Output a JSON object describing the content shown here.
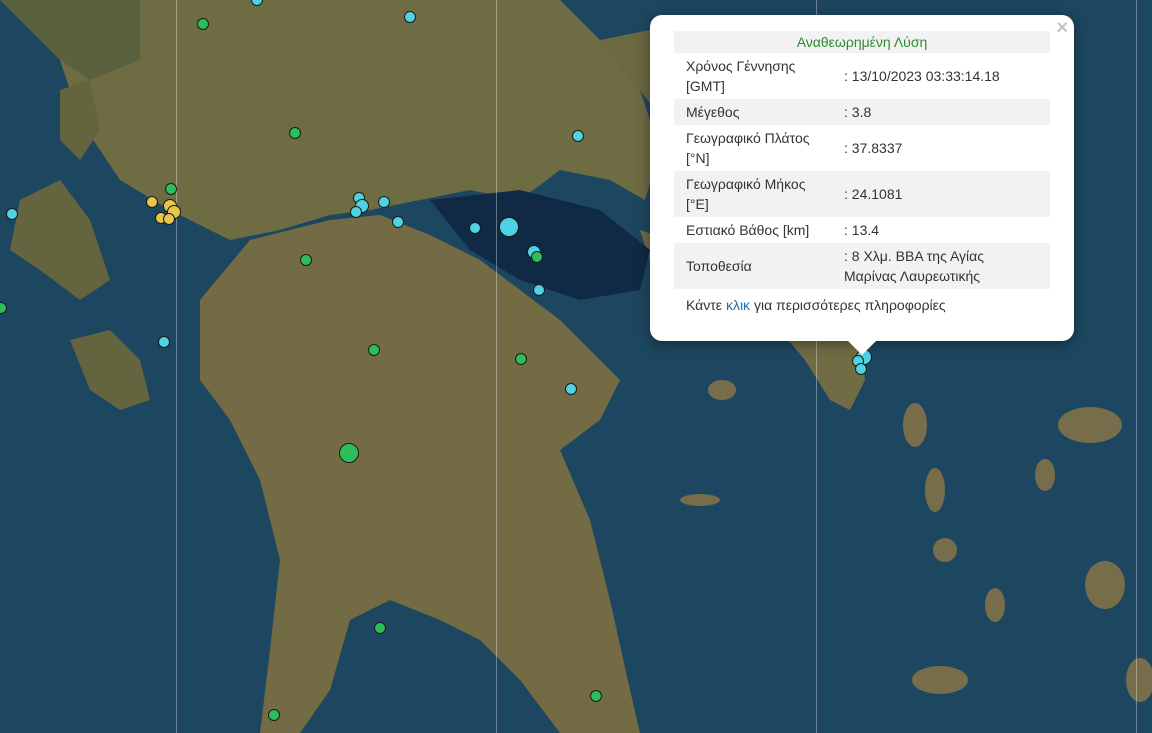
{
  "popup": {
    "title": "Αναθεωρημένη Λύση",
    "close_glyph": "×",
    "rows": [
      {
        "label": "Χρόνος Γέννησης [GMT]",
        "value": ": 13/10/2023 03:33:14.18"
      },
      {
        "label": "Μέγεθος",
        "value": ": 3.8"
      },
      {
        "label": "Γεωγραφικό Πλάτος [°N]",
        "value": ": 37.8337"
      },
      {
        "label": "Γεωγραφικό Μήκος [°E]",
        "value": ": 24.1081"
      },
      {
        "label": "Εστιακό Βάθος [km]",
        "value": ": 13.4"
      },
      {
        "label": "Τοποθεσία",
        "value": ": 8 Χλμ. ΒΒΑ της Αγίας Μαρίνας Λαυρεωτικής"
      }
    ],
    "more_prefix": "Κάντε",
    "more_link": "κλικ",
    "more_suffix": "για περισσότερες πληροφορίες"
  },
  "colors": {
    "sea": "#1d4760",
    "land": "#6b6a3f",
    "quake_recent": "#4fd3e3",
    "quake_older": "#2ebd5b",
    "quake_yellow": "#e3c64a"
  }
}
